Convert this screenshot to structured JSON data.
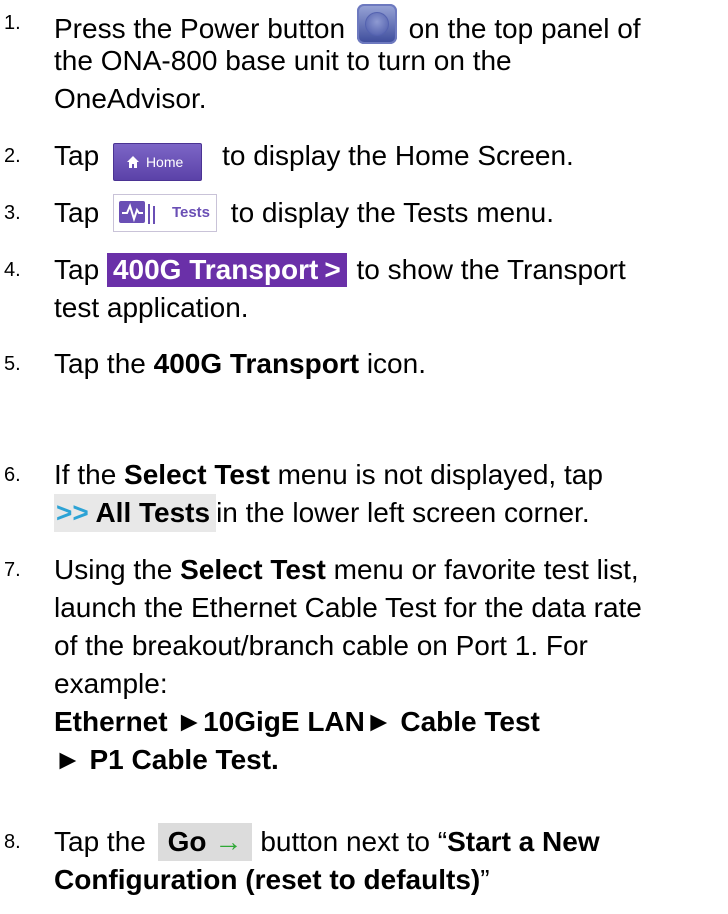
{
  "steps": [
    {
      "number": "1.",
      "lines": [
        {
          "pre": "Press the Power button",
          "post": "on the top panel of"
        },
        {
          "text": "the ONA-800 base unit to turn on the"
        },
        {
          "text": "OneAdvisor."
        }
      ]
    },
    {
      "number": "2.",
      "pre": "Tap",
      "button": "Home",
      "post": "to display the Home Screen."
    },
    {
      "number": "3.",
      "pre": "Tap",
      "button": "Tests",
      "post": "to display the Tests menu."
    },
    {
      "number": "4.",
      "pre": "Tap",
      "button": "400G Transport",
      "button_suffix": ">",
      "post": "to show the Transport",
      "line2": "test application."
    },
    {
      "number": "5.",
      "pre": "Tap the",
      "bold": "400G Transport",
      "post": "icon."
    },
    {
      "number": "6.",
      "pre": "If the",
      "bold": "Select Test",
      "post": "menu is not displayed, tap",
      "line2_arrow": ">>",
      "line2_bold": "All Tests",
      "line2_post": "in the lower left screen corner."
    },
    {
      "number": "7.",
      "pre": "Using the",
      "bold": "Select Test",
      "post": "menu or favorite test list,",
      "lines": [
        "launch the Ethernet Cable Test for the data rate",
        "of the breakout/branch cable on Port 1.  For",
        "example:"
      ],
      "path1": "Ethernet ►10GigE LAN► Cable Test",
      "path2": "► P1 Cable Test."
    },
    {
      "number": "8.",
      "pre": "Tap the",
      "button": "Go",
      "button_arrow": "→",
      "post": "button next to “",
      "bold": "Start a New",
      "bold_line2": "Configuration (reset to defaults)",
      "close_quote": "”"
    }
  ],
  "colors": {
    "home_button": "#5b42a8",
    "tests_icon": "#6a4fb5",
    "transport_button": "#6a30a8",
    "all_tests_arrow": "#2da3d5",
    "go_arrow": "#2fa836"
  }
}
